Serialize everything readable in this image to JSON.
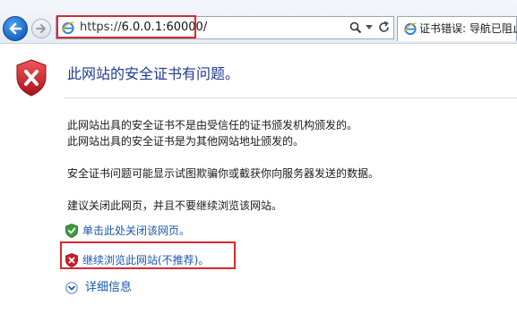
{
  "browser": {
    "url_prefix": "https://",
    "url_host": "6.0.0.1:60000/",
    "tab_title": "证书错误: 导航已阻止"
  },
  "page": {
    "title": "此网站的安全证书有问题。",
    "paragraphs": [
      "此网站出具的安全证书不是由受信任的证书颁发机构颁发的。",
      "此网站出具的安全证书是为其他网站地址颁发的。",
      "安全证书问题可能显示试图欺骗你或截获你向服务器发送的数据。",
      "建议关闭此网页，并且不要继续浏览该网站。"
    ],
    "links": {
      "close": "单击此处关闭该网页。",
      "continue": "继续浏览此网站(不推荐)。",
      "more_info": "详细信息"
    }
  },
  "colors": {
    "title": "#1f3a93",
    "link": "#1a56b0",
    "highlight_box": "#d9282f",
    "shield_red": "#c8202a",
    "shield_green": "#3a9a3a"
  },
  "icons": {
    "back": "back-arrow-icon",
    "forward": "forward-arrow-icon",
    "site": "ie-page-icon",
    "search": "search-icon",
    "dropdown": "chevron-down-icon",
    "refresh": "refresh-icon",
    "warning": "red-shield-x-icon",
    "close_link": "green-shield-check-icon",
    "continue_link": "red-shield-x-icon",
    "more_info": "circle-chevron-down-icon"
  }
}
